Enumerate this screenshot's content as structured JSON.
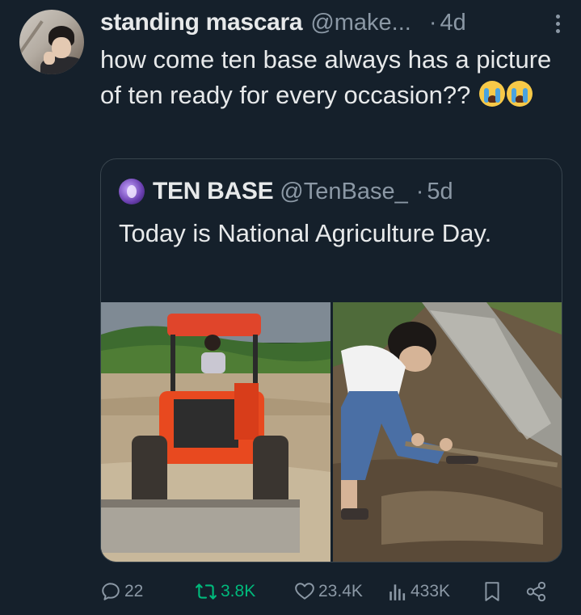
{
  "tweet": {
    "author": {
      "display_name": "standing mascara",
      "handle": "@make...",
      "avatar_icon": "user-avatar-icon"
    },
    "separator": "·",
    "time": "4d",
    "text": "how come ten base always has a picture of ten ready for every occasion??",
    "emojis": [
      "loudly-crying-face-icon",
      "loudly-crying-face-icon"
    ]
  },
  "quote": {
    "author": {
      "display_name": "TEN BASE",
      "handle": "@TenBase_",
      "avatar_icon": "ten-base-avatar-icon"
    },
    "separator": "·",
    "time": "5d",
    "text": "Today is National Agriculture Day.",
    "media": [
      {
        "description_icon": "photo-man-on-red-tractor"
      },
      {
        "description_icon": "photo-man-digging-with-hoe"
      }
    ]
  },
  "actions": {
    "replies": "22",
    "reposts": "3.8K",
    "likes": "23.4K",
    "views": "433K"
  },
  "colors": {
    "background": "#15202b",
    "text_primary": "#e7e9ea",
    "text_secondary": "#8b98a5",
    "border": "#38444d",
    "repost_green": "#00ba7c"
  }
}
